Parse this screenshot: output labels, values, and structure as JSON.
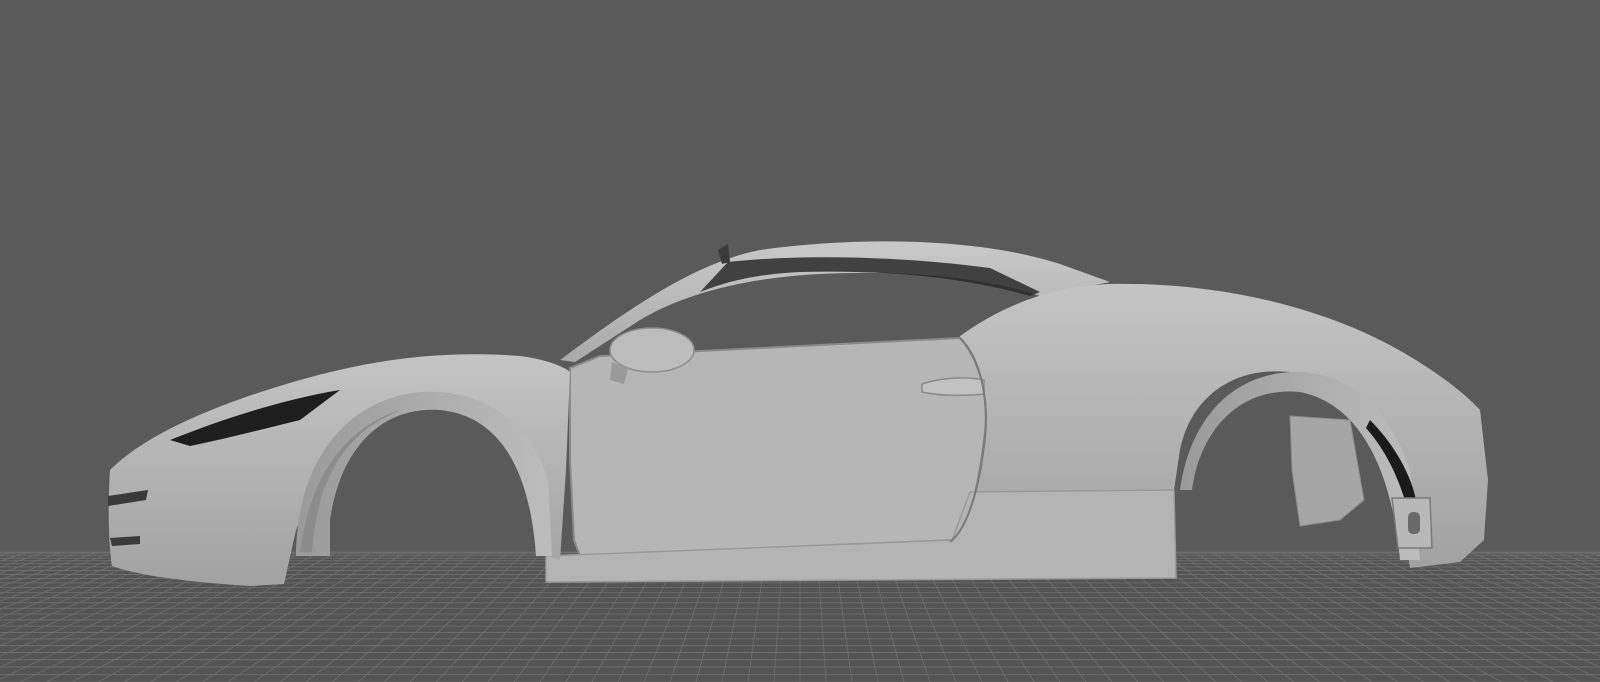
{
  "app": {
    "view": "3d-viewport",
    "scene_object": "car-body-shell",
    "shading": "smooth-shaded-default-material"
  },
  "colors": {
    "background": "#5a5a5a",
    "grid": "#6f6f6f",
    "grid_ground": "#545454",
    "body": "#b2b2b2",
    "body_light": "#bfbfbf",
    "body_shadow": "#8e8e8e",
    "cavity": "#1a1a1a"
  },
  "icons": {
    "viewport_grid": "grid-plane",
    "model": "car-body-mesh"
  }
}
